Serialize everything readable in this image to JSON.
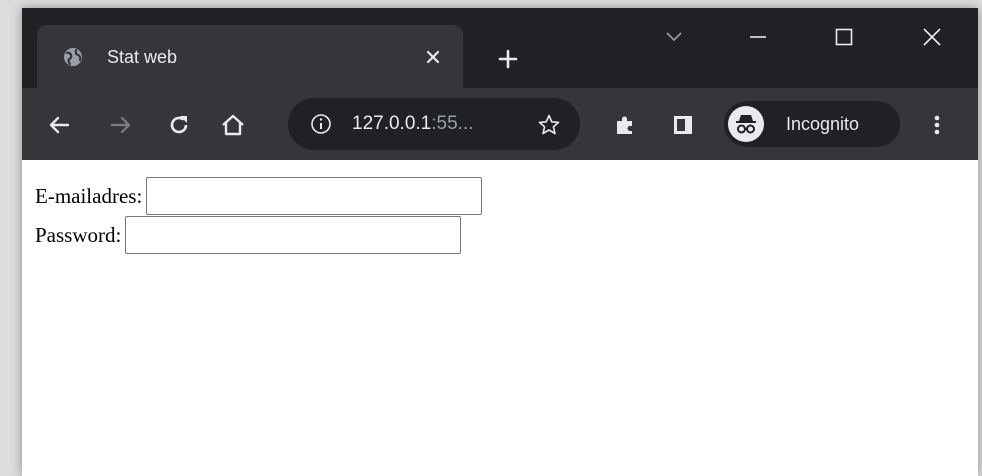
{
  "browser": {
    "tab": {
      "title": "Stat web",
      "favicon": "globe-icon"
    },
    "new_tab_icon": "plus-icon",
    "window_controls": [
      "chevron-down-icon",
      "minimize-icon",
      "maximize-icon",
      "close-icon"
    ],
    "toolbar": {
      "back_icon": "arrow-left-icon",
      "forward_icon": "arrow-right-icon",
      "reload_icon": "reload-icon",
      "home_icon": "home-icon",
      "address": {
        "info_icon": "info-icon",
        "url_host": "127.0.0.1",
        "url_rest": ":55...",
        "bookmark_icon": "star-icon"
      },
      "extensions_icon": "puzzle-icon",
      "side_panel_icon": "side-panel-icon",
      "incognito_label": "Incognito",
      "incognito_icon": "incognito-icon",
      "menu_icon": "kebab-menu-icon"
    },
    "colors": {
      "tabstrip": "#202124",
      "toolbar": "#35363a",
      "text": "#e8eaed",
      "muted": "#9aa0a6"
    }
  },
  "page": {
    "form": {
      "email_label": "E-mailadres:",
      "email_value": "",
      "password_label": "Password:",
      "password_value": ""
    }
  }
}
